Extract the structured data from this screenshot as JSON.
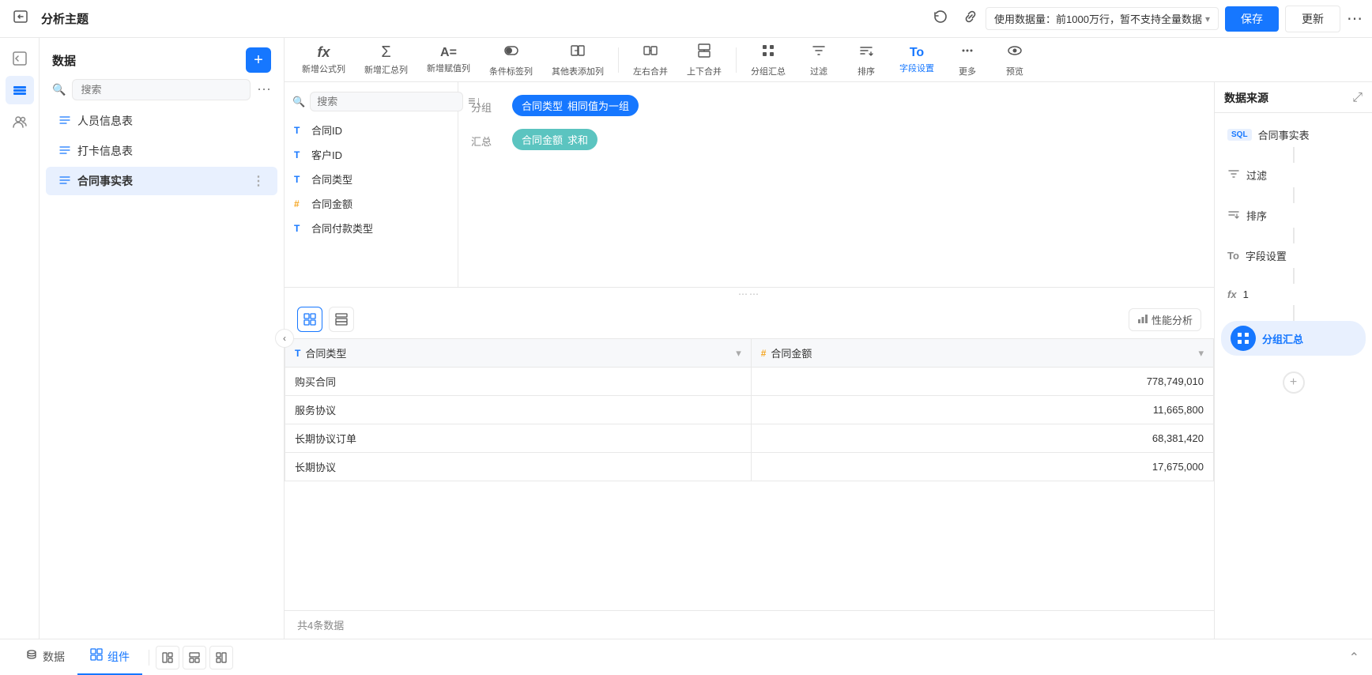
{
  "topbar": {
    "back_icon": "←",
    "title": "分析主题",
    "refresh_icon": "↻",
    "link_icon": "⛓",
    "data_usage_text": "使用数据量：前1000万行，暂不支持全量数据",
    "data_usage_chevron": "▾",
    "save_label": "保存",
    "update_label": "更新",
    "more_icon": "⋯"
  },
  "left_sidebar": {
    "items": [
      {
        "icon": "⬚",
        "name": "back-icon"
      },
      {
        "icon": "📊",
        "name": "chart-icon",
        "active": true
      },
      {
        "icon": "👥",
        "name": "users-icon"
      }
    ]
  },
  "data_panel": {
    "title": "数据",
    "add_icon": "+",
    "search_placeholder": "搜索",
    "more_icon": "⋯",
    "items": [
      {
        "icon": "📈",
        "label": "人员信息表",
        "active": false
      },
      {
        "icon": "📈",
        "label": "打卡信息表",
        "active": false
      },
      {
        "icon": "📋",
        "label": "合同事实表",
        "active": true
      }
    ],
    "collapse_icon": "‹"
  },
  "toolbar": {
    "items": [
      {
        "icon": "fx",
        "label": "新增公式列",
        "name": "add-formula-col"
      },
      {
        "icon": "Σ",
        "label": "新增汇总列",
        "name": "add-sum-col"
      },
      {
        "icon": "A=",
        "label": "新增赋值列",
        "name": "add-assign-col"
      },
      {
        "icon": "⚑",
        "label": "条件标签列",
        "name": "add-condition-col"
      },
      {
        "icon": "⊞",
        "label": "其他表添加列",
        "name": "add-other-col"
      },
      {
        "divider": true
      },
      {
        "icon": "◫◫",
        "label": "左右合并",
        "name": "merge-lr"
      },
      {
        "icon": "⊟",
        "label": "上下合并",
        "name": "merge-tb"
      },
      {
        "divider": true
      },
      {
        "icon": "品",
        "label": "分组汇总",
        "name": "group-summary"
      },
      {
        "icon": "▽",
        "label": "过滤",
        "name": "filter"
      },
      {
        "icon": "≡↓",
        "label": "排序",
        "name": "sort"
      },
      {
        "icon": "To",
        "label": "字段设置",
        "name": "field-settings"
      },
      {
        "icon": "⊕",
        "label": "更多",
        "name": "more"
      },
      {
        "icon": "👁",
        "label": "预览",
        "name": "preview"
      }
    ]
  },
  "field_list": {
    "search_placeholder": "搜索",
    "sort_icon": "≡",
    "fields": [
      {
        "type": "T",
        "label": "合同ID",
        "is_hash": false
      },
      {
        "type": "T",
        "label": "客户ID",
        "is_hash": false
      },
      {
        "type": "T",
        "label": "合同类型",
        "is_hash": false
      },
      {
        "type": "#",
        "label": "合同金额",
        "is_hash": true
      },
      {
        "type": "T",
        "label": "合同付款类型",
        "is_hash": false
      }
    ]
  },
  "config": {
    "group_label": "分组",
    "group_chips": [
      {
        "text": "合同类型",
        "sub": "相同值为一组",
        "color": "blue"
      }
    ],
    "summary_label": "汇总",
    "summary_chips": [
      {
        "text": "合同金额",
        "sub": "求和",
        "color": "teal"
      }
    ]
  },
  "table": {
    "view_grid_icon": "⊞",
    "view_list_icon": "⊟",
    "perf_icon": "📊",
    "perf_label": "性能分析",
    "columns": [
      {
        "type": "T",
        "label": "合同类型",
        "is_hash": false
      },
      {
        "type": "#",
        "label": "合同金额",
        "is_hash": true
      }
    ],
    "rows": [
      {
        "col1": "购买合同",
        "col2": "778,749,010"
      },
      {
        "col1": "服务协议",
        "col2": "11,665,800"
      },
      {
        "col1": "长期协议订单",
        "col2": "68,381,420"
      },
      {
        "col1": "长期协议",
        "col2": "17,675,000"
      }
    ],
    "footer": "共4条数据"
  },
  "right_panel": {
    "title": "数据来源",
    "expand_icon": "⤢",
    "pipeline": [
      {
        "type": "sql",
        "label": "合同事实表",
        "icon": "sql",
        "is_circle": false
      },
      {
        "type": "filter",
        "label": "过滤",
        "icon": "▽",
        "is_circle": false
      },
      {
        "type": "sort",
        "label": "排序",
        "icon": "≡↓",
        "is_circle": false
      },
      {
        "type": "field",
        "label": "字段设置",
        "icon": "To",
        "is_circle": false
      },
      {
        "type": "formula",
        "label": "1",
        "icon": "fx",
        "is_circle": false
      },
      {
        "type": "group",
        "label": "分组汇总",
        "icon": "品",
        "is_active": true,
        "is_circle": true
      }
    ],
    "add_icon": "+"
  },
  "bottombar": {
    "tabs": [
      {
        "icon": "🗄",
        "label": "数据",
        "active": false
      },
      {
        "icon": "⊞",
        "label": "组件",
        "active": true
      }
    ],
    "tool_btns": [
      {
        "icon": "⊞",
        "name": "layout-btn-1"
      },
      {
        "icon": "⊟",
        "name": "layout-btn-2"
      },
      {
        "icon": "⊞",
        "name": "layout-btn-3"
      }
    ],
    "expand_icon": "⌃"
  }
}
